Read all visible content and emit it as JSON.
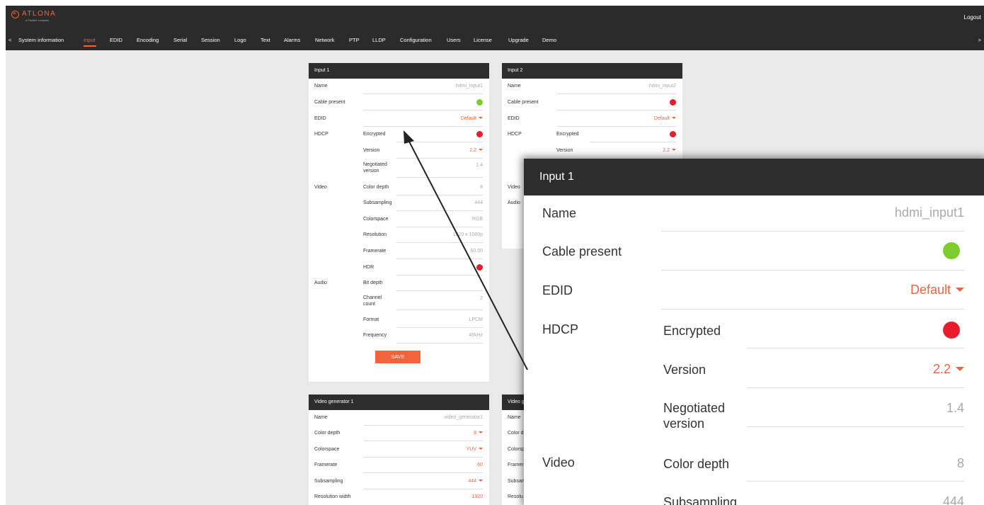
{
  "header": {
    "brand": "ATLONA",
    "brand_sub": "a Panduit company",
    "logout": "Logout"
  },
  "nav": {
    "left_arrow": "<",
    "right_arrow": ">",
    "items": [
      {
        "label": "System information"
      },
      {
        "label": "Input"
      },
      {
        "label": "EDID"
      },
      {
        "label": "Encoding"
      },
      {
        "label": "Serial"
      },
      {
        "label": "Session"
      },
      {
        "label": "Logo"
      },
      {
        "label": "Text"
      },
      {
        "label": "Alarms"
      },
      {
        "label": "Network"
      },
      {
        "label": "PTP"
      },
      {
        "label": "LLDP"
      },
      {
        "label": "Configuration"
      },
      {
        "label": "Users"
      },
      {
        "label": "License"
      },
      {
        "label": "Upgrade"
      },
      {
        "label": "Demo"
      }
    ],
    "active": "Input"
  },
  "input1": {
    "title": "Input 1",
    "name_label": "Name",
    "name_value": "hdmi_input1",
    "cable_label": "Cable present",
    "cable_status": "green",
    "edid_label": "EDID",
    "edid_value": "Default",
    "hdcp_label": "HDCP",
    "encrypted_label": "Encrypted",
    "encrypted_status": "red",
    "version_label": "Version",
    "version_value": "2.2",
    "negotiated_label": "Negotiated version",
    "negotiated_value": "1.4",
    "video_label": "Video",
    "color_depth_label": "Color depth",
    "color_depth_value": "8",
    "subsampling_label": "Subsampling",
    "subsampling_value": "444",
    "colorspace_label": "Colorspace",
    "colorspace_value": "RGB",
    "resolution_label": "Resolution",
    "resolution_value": "1920 x 1080p",
    "framerate_label": "Framerate",
    "framerate_value": "60.00",
    "hdr_label": "HDR",
    "hdr_status": "red",
    "audio_label": "Audio",
    "bit_depth_label": "Bit depth",
    "bit_depth_value": "",
    "channel_label": "Channel count",
    "channel_value": "2",
    "format_label": "Format",
    "format_value": "LPCM",
    "frequency_label": "Frequency",
    "frequency_value": "48kHz",
    "save_label": "SAVE"
  },
  "input2": {
    "title": "Input 2",
    "name_label": "Name",
    "name_value": "hdmi_input2",
    "cable_label": "Cable present",
    "cable_status": "red",
    "edid_label": "EDID",
    "edid_value": "Default",
    "hdcp_label": "HDCP",
    "encrypted_label": "Encrypted",
    "encrypted_status": "red",
    "version_label": "Version",
    "version_value": "2.2",
    "video_label": "Video",
    "audio_label": "Audio"
  },
  "vg1": {
    "title": "Video generator 1",
    "name_label": "Name",
    "name_value": "video_generator1",
    "color_depth_label": "Color depth",
    "color_depth_value": "8",
    "colorspace_label": "Colorspace",
    "colorspace_value": "YUV",
    "framerate_label": "Framerate",
    "framerate_value": "60",
    "subsampling_label": "Subsampling",
    "subsampling_value": "444",
    "res_width_label": "Resolution width",
    "res_width_value": "1920"
  },
  "vg2": {
    "title": "Video g",
    "name_label": "Name",
    "color_depth_label": "Color d",
    "colorspace_label": "Colorsp",
    "framerate_label": "Framer",
    "subsampling_label": "Subsan",
    "resolution_label": "Resolu"
  },
  "colors": {
    "accent": "#f0643c",
    "ok": "#7dcc2e",
    "error": "#e81c2c",
    "header": "#2d2d2d"
  }
}
